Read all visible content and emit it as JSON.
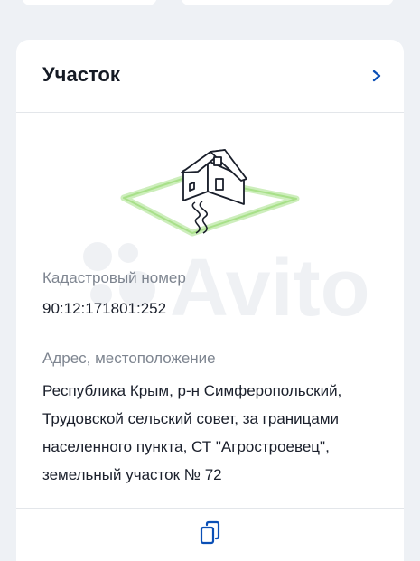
{
  "card": {
    "title": "Участок"
  },
  "fields": {
    "cadastral": {
      "label": "Кадастровый номер",
      "value": "90:12:171801:252"
    },
    "address": {
      "label": "Адрес, местоположение",
      "lines": [
        "Республика Крым, р-н Симферопольский,",
        "Трудовской сельский совет, за границами",
        "населенного пункта, СТ \"Агростроевец\",",
        "земельный участок № 72"
      ]
    }
  },
  "watermark": {
    "text": "Avito"
  },
  "icons": {
    "header_action": "chevron-right-icon",
    "illustration": "house-on-plot-icon",
    "footer_action": "copy-icon"
  },
  "colors": {
    "accent": "#0a4fb6",
    "plot_outline": "#a8e089",
    "label": "#7e8590",
    "text": "#1a1f2b"
  }
}
